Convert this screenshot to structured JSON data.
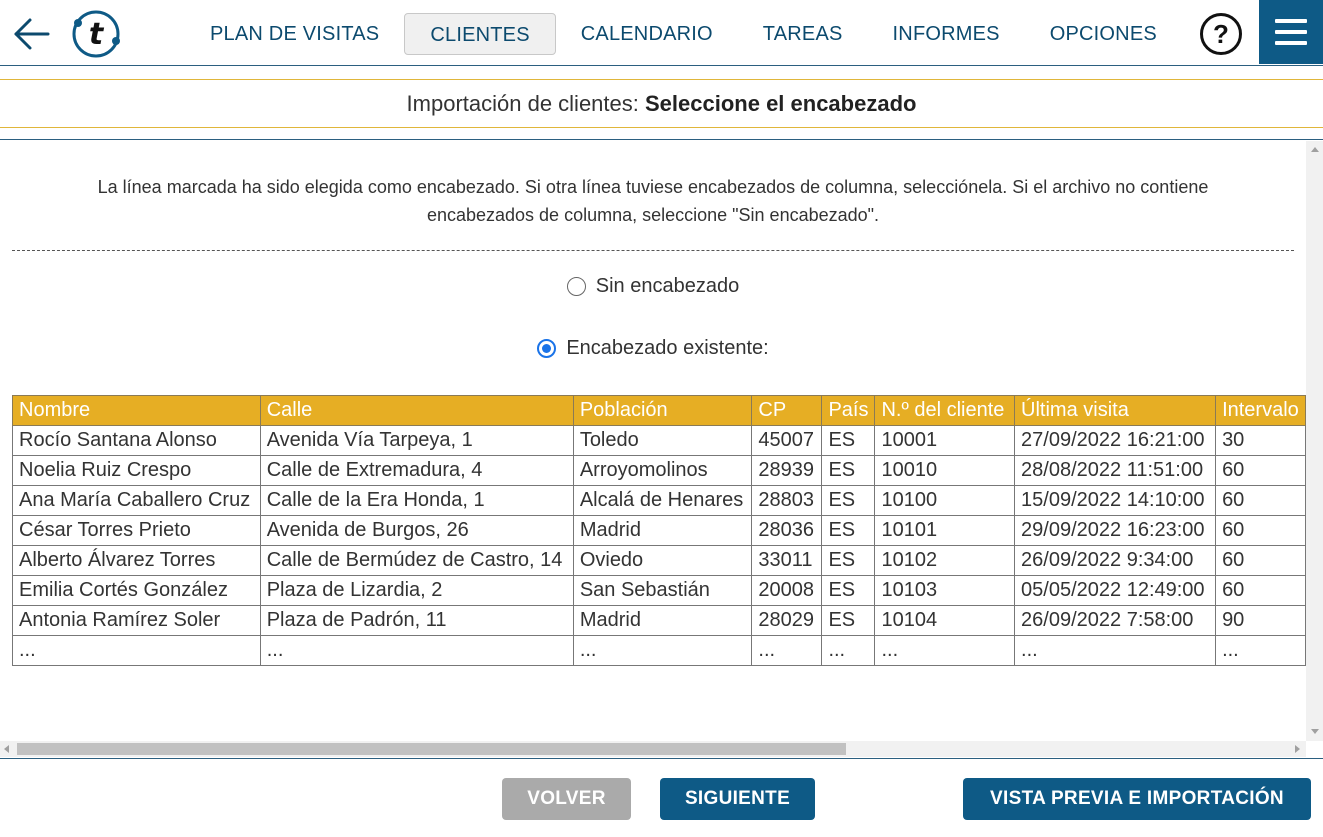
{
  "nav": {
    "items": [
      {
        "label": "PLAN DE VISITAS",
        "active": false
      },
      {
        "label": "CLIENTES",
        "active": true
      },
      {
        "label": "CALENDARIO",
        "active": false
      },
      {
        "label": "TAREAS",
        "active": false
      },
      {
        "label": "INFORMES",
        "active": false
      },
      {
        "label": "OPCIONES",
        "active": false
      }
    ],
    "help_label": "?"
  },
  "title": {
    "prefix": "Importación de clientes: ",
    "bold": "Seleccione el encabezado"
  },
  "intro": {
    "line1": "La línea marcada ha sido elegida como encabezado. Si otra línea tuviese encabezados de columna, selecciónela. Si el archivo no contiene",
    "line2": "encabezados de columna, seleccione \"Sin encabezado\"."
  },
  "options": {
    "no_header": {
      "label": "Sin encabezado",
      "checked": false
    },
    "existing_header": {
      "label": "Encabezado existente:",
      "checked": true
    }
  },
  "table": {
    "headers": [
      "Nombre",
      "Calle",
      "Población",
      "CP",
      "País",
      "N.º del cliente",
      "Última visita",
      "Intervalo"
    ],
    "rows": [
      [
        "Rocío Santana Alonso",
        "Avenida Vía Tarpeya, 1",
        "Toledo",
        "45007",
        "ES",
        "10001",
        "27/09/2022 16:21:00",
        "30"
      ],
      [
        "Noelia Ruiz Crespo",
        "Calle de Extremadura, 4",
        "Arroyomolinos",
        "28939",
        "ES",
        "10010",
        "28/08/2022 11:51:00",
        "60"
      ],
      [
        "Ana María Caballero Cruz",
        "Calle de la Era Honda, 1",
        "Alcalá de Henares",
        "28803",
        "ES",
        "10100",
        "15/09/2022 14:10:00",
        "60"
      ],
      [
        "César Torres Prieto",
        "Avenida de Burgos, 26",
        "Madrid",
        "28036",
        "ES",
        "10101",
        "29/09/2022 16:23:00",
        "60"
      ],
      [
        "Alberto Álvarez Torres",
        "Calle de Bermúdez de Castro, 14",
        "Oviedo",
        "33011",
        "ES",
        "10102",
        "26/09/2022 9:34:00",
        "60"
      ],
      [
        "Emilia Cortés González",
        "Plaza de Lizardia, 2",
        "San Sebastián",
        "20008",
        "ES",
        "10103",
        "05/05/2022 12:49:00",
        "60"
      ],
      [
        "Antonia Ramírez Soler",
        "Plaza de Padrón, 11",
        "Madrid",
        "28029",
        "ES",
        "10104",
        "26/09/2022 7:58:00",
        "90"
      ],
      [
        "...",
        "...",
        "...",
        "...",
        "...",
        "...",
        "...",
        "..."
      ]
    ]
  },
  "footer": {
    "back_label": "VOLVER",
    "next_label": "SIGUIENTE",
    "preview_label": "VISTA PREVIA E IMPORTACIÓN"
  },
  "colors": {
    "primary": "#0e5a86",
    "header_bg": "#e6ae24",
    "disabled": "#aaaaaa",
    "radio_accent": "#1a73e8"
  },
  "icons": {
    "back": "arrow-left-icon",
    "logo": "t-logo-icon",
    "help": "question-mark-icon",
    "menu": "hamburger-menu-icon"
  }
}
